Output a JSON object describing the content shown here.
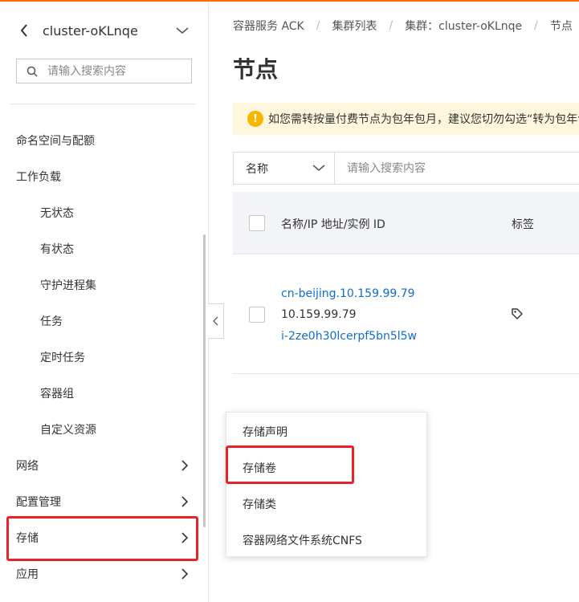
{
  "sidebar": {
    "cluster_name": "cluster-oKLnqe",
    "search_placeholder": "请输入搜索内容",
    "nav": {
      "namespaces": "命名空间与配额",
      "workloads": "工作负载",
      "stateless": "无状态",
      "stateful": "有状态",
      "daemonsets": "守护进程集",
      "jobs": "任务",
      "cronjobs": "定时任务",
      "pods": "容器组",
      "custom_resources": "自定义资源",
      "network": "网络",
      "config": "配置管理",
      "storage": "存储",
      "applications": "应用"
    }
  },
  "breadcrumb": {
    "item1": "容器服务 ACK",
    "item2": "集群列表",
    "item3": "集群：cluster-oKLnqe",
    "item4": "节点"
  },
  "page": {
    "title": "节点",
    "notice": "如您需转按量付费节点为包年包月，建议您切勿勾选“转为包年包月”"
  },
  "filter": {
    "select_value": "名称",
    "search_placeholder": "请输入搜索内容"
  },
  "table": {
    "col_name": "名称/IP 地址/实例 ID",
    "col_tags": "标签",
    "rows": [
      {
        "name": "cn-beijing.10.159.99.79",
        "ip": "10.159.99.79",
        "instance_id": "i-2ze0h30lcerpf5bn5l5w"
      }
    ]
  },
  "storage_menu": {
    "pvc": "存储声明",
    "pv": "存储卷",
    "storage_class": "存储类",
    "cnfs": "容器网络文件系统CNFS"
  },
  "colors": {
    "accent": "#ff6a00",
    "link": "#0f6ecd",
    "highlight": "#e8242a",
    "warning": "#f6b600"
  }
}
